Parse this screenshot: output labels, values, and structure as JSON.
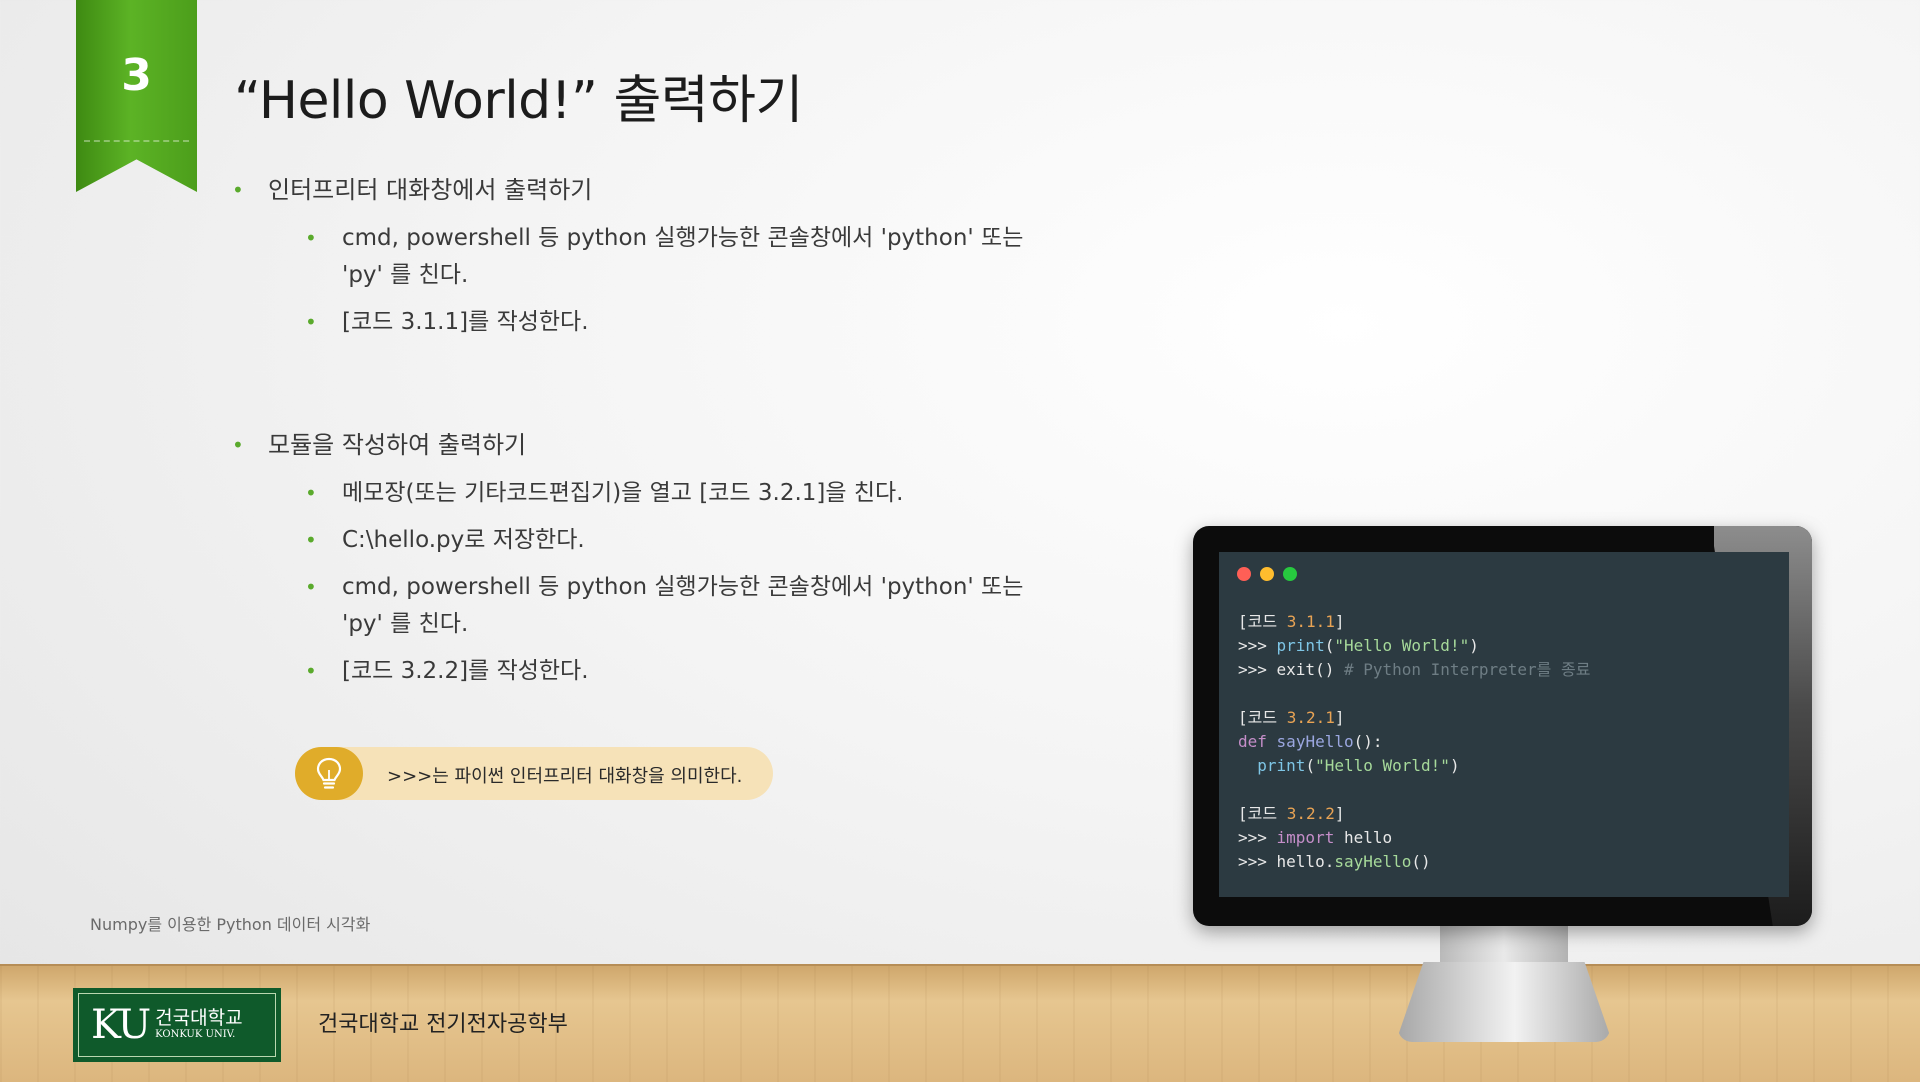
{
  "slide": {
    "section_number": "3",
    "title": "“Hello World!” 출력하기",
    "bullets": [
      {
        "text": "인터프리터 대화창에서 출력하기",
        "sub": [
          "cmd, powershell 등 python 실행가능한 콘솔창에서 'python' 또는 'py' 를 친다.",
          "[코드 3.1.1]를 작성한다."
        ]
      },
      {
        "text": "모듈을 작성하여 출력하기",
        "sub": [
          "메모장(또는 기타코드편집기)을 열고 [코드 3.2.1]을 친다.",
          "C:\\hello.py로 저장한다.",
          "cmd, powershell 등 python 실행가능한 콘솔창에서 'python' 또는 'py' 를 친다.",
          "[코드 3.2.2]를 작성한다."
        ]
      }
    ],
    "tip": {
      "icon": "lightbulb-icon",
      "text": ">>>는 파이썬 인터프리터 대화창을 의미한다."
    },
    "footer_note": "Numpy를 이용한 Python 데이터 시각화",
    "university": {
      "logo_mark": "KU",
      "logo_korean": "건국대학교",
      "logo_english": "KONKUK UNIV.",
      "department": "건국대학교 전기전자공학부"
    },
    "code_window": {
      "dot_colors": [
        "#ff5f56",
        "#ffbd2e",
        "#27c93f"
      ],
      "blocks": [
        {
          "label_prefix": "[코드 ",
          "label_num": "3.1.1",
          "label_suffix": "]",
          "lines": [
            {
              "prompt": ">>> ",
              "fn": "print",
              "open": "(",
              "str": "\"Hello World!\"",
              "close": ")"
            },
            {
              "prompt": ">>> ",
              "plain": "exit() ",
              "comment": "# Python Interpreter를 종료"
            }
          ]
        },
        {
          "label_prefix": "[코드 ",
          "label_num": "3.2.1",
          "label_suffix": "]",
          "def_keyword": "def",
          "def_name": "sayHello",
          "def_tail": "():",
          "body_fn": "print",
          "body_open": "(",
          "body_str": "\"Hello World!\"",
          "body_close": ")"
        },
        {
          "label_prefix": "[코드 ",
          "label_num": "3.2.2",
          "label_suffix": "]",
          "import_prompt": ">>> ",
          "import_kw": "import",
          "import_mod": " hello",
          "call_prompt": ">>> ",
          "call_obj": "hello.",
          "call_fn": "sayHello",
          "call_parens": "()"
        }
      ]
    },
    "colors": {
      "ribbon_green": "#4c9e1b",
      "bullet_green": "#5aaa2c",
      "tip_background": "#f6e2b8",
      "tip_bulb": "#e0ac2a",
      "ku_green": "#0f5a2b",
      "code_background": "#2c3a41"
    }
  }
}
